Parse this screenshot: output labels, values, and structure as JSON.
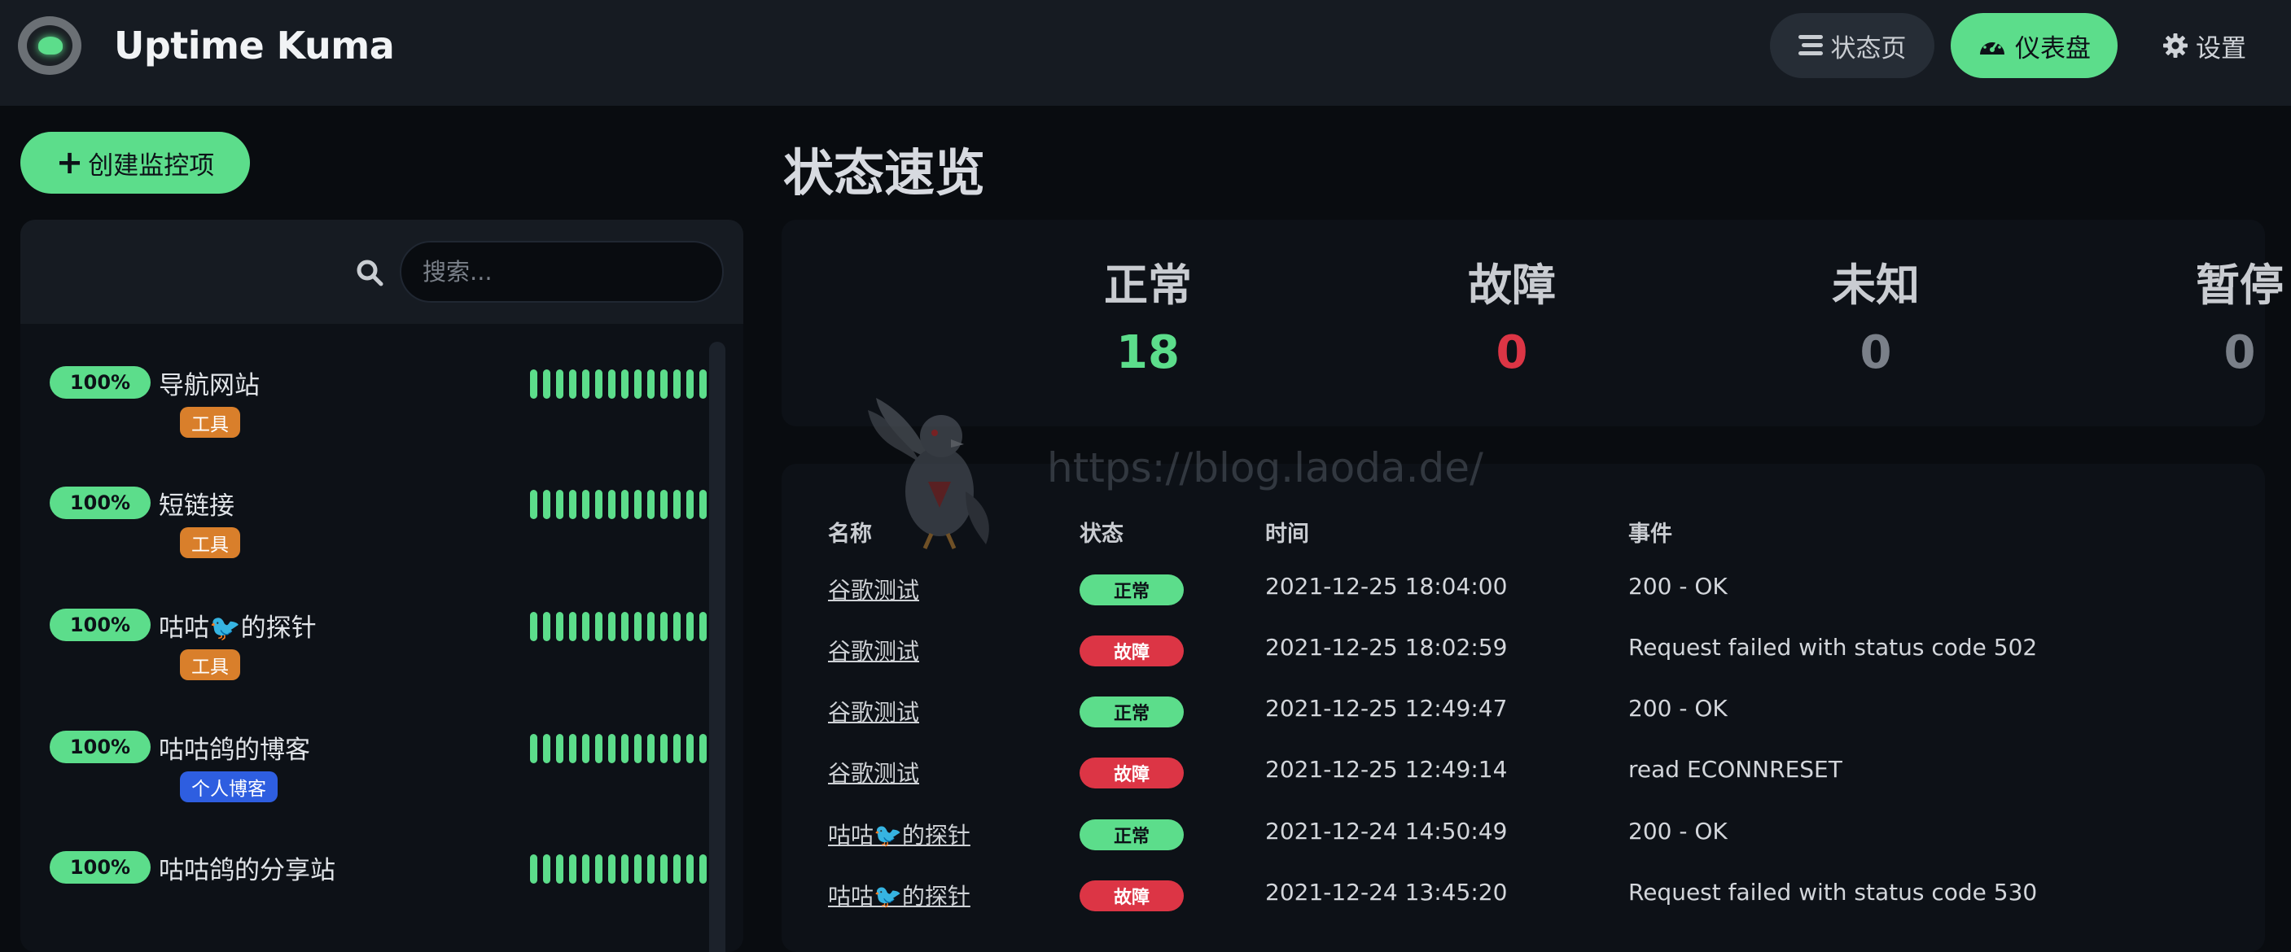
{
  "app": {
    "name": "Uptime Kuma",
    "logo": "uptime-kuma-logo"
  },
  "nav": {
    "status_page": {
      "label": "状态页",
      "icon": "list-icon"
    },
    "dashboard": {
      "label": "仪表盘",
      "icon": "gauge-icon",
      "active": true
    },
    "settings": {
      "label": "设置",
      "icon": "gear-icon"
    }
  },
  "sidebar": {
    "create_label": "创建监控项",
    "search": {
      "placeholder": "搜索...",
      "value": ""
    },
    "monitors": [
      {
        "uptime": "100%",
        "name": "导航网站",
        "tag": "工具",
        "tag_color": "#d97f2b",
        "beats": 15
      },
      {
        "uptime": "100%",
        "name": "短链接",
        "tag": "工具",
        "tag_color": "#d97f2b",
        "beats": 15
      },
      {
        "uptime": "100%",
        "name": "咕咕🐦的探针",
        "tag": "工具",
        "tag_color": "#d97f2b",
        "beats": 15
      },
      {
        "uptime": "100%",
        "name": "咕咕鸽的博客",
        "tag": "个人博客",
        "tag_color": "#2e5ee0",
        "beats": 15
      },
      {
        "uptime": "100%",
        "name": "咕咕鸽的分享站",
        "tag": "",
        "tag_color": "",
        "beats": 15
      }
    ]
  },
  "main": {
    "title": "状态速览",
    "stats": [
      {
        "label": "正常",
        "value": "18",
        "color": "#5cdd8b"
      },
      {
        "label": "故障",
        "value": "0",
        "color": "#dc3545"
      },
      {
        "label": "未知",
        "value": "0",
        "color": "#7a8089"
      },
      {
        "label": "暂停",
        "value": "0",
        "color": "#7a8089"
      }
    ],
    "events": {
      "columns": [
        "名称",
        "状态",
        "时间",
        "事件"
      ],
      "rows": [
        {
          "name": "谷歌测试",
          "status": "正常",
          "ok": true,
          "time": "2021-12-25 18:04:00",
          "msg": "200 - OK"
        },
        {
          "name": "谷歌测试",
          "status": "故障",
          "ok": false,
          "time": "2021-12-25 18:02:59",
          "msg": "Request failed with status code 502"
        },
        {
          "name": "谷歌测试",
          "status": "正常",
          "ok": true,
          "time": "2021-12-25 12:49:47",
          "msg": "200 - OK"
        },
        {
          "name": "谷歌测试",
          "status": "故障",
          "ok": false,
          "time": "2021-12-25 12:49:14",
          "msg": "read ECONNRESET"
        },
        {
          "name": "咕咕🐦的探针",
          "status": "正常",
          "ok": true,
          "time": "2021-12-24 14:50:49",
          "msg": "200 - OK"
        },
        {
          "name": "咕咕🐦的探针",
          "status": "故障",
          "ok": false,
          "time": "2021-12-24 13:45:20",
          "msg": "Request failed with status code 530"
        }
      ]
    }
  },
  "watermark": {
    "text": "https://blog.laoda.de/",
    "icon": "pigeon-icon"
  },
  "colors": {
    "accent": "#5cdd8b",
    "danger": "#dc3545",
    "bg": "#090c10",
    "panel": "#0d1117",
    "header": "#161b22"
  }
}
